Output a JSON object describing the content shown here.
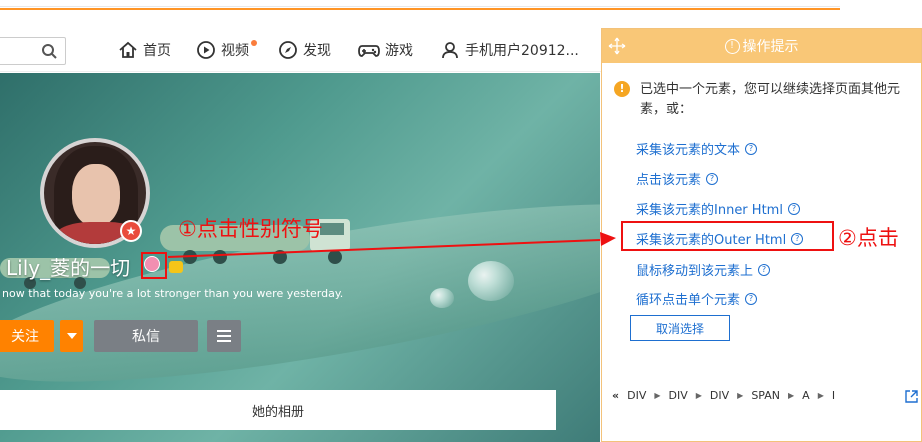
{
  "nav": {
    "items": [
      {
        "label": "首页",
        "icon": "home-icon"
      },
      {
        "label": "视频",
        "icon": "video-icon"
      },
      {
        "label": "发现",
        "icon": "compass-icon"
      },
      {
        "label": "游戏",
        "icon": "gamepad-icon"
      },
      {
        "label": "手机用户20912...",
        "icon": "user-icon"
      }
    ]
  },
  "profile": {
    "username": "Lily_菱的一切",
    "signature": "now that today you're a lot stronger than you were yesterday.",
    "follow_label": "关注",
    "message_label": "私信",
    "album_label": "她的相册"
  },
  "annotations": {
    "step1": "①点击性别符号",
    "step2": "②点击"
  },
  "panel": {
    "title": "操作提示",
    "description": "已选中一个元素，您可以继续选择页面其他元素，或：",
    "options": [
      "采集该元素的文本",
      "点击该元素",
      "采集该元素的Inner Html",
      "采集该元素的Outer Html",
      "鼠标移动到该元素上",
      "循环点击单个元素"
    ],
    "cancel_label": "取消选择",
    "breadcrumb": [
      "DIV",
      "DIV",
      "DIV",
      "SPAN",
      "A",
      "I"
    ],
    "breadcrumb_prefix": "«"
  },
  "colors": {
    "accent": "#ff8200",
    "panel_header": "#f9c777",
    "link": "#1e6fd0",
    "annotation": "#ee1111"
  }
}
